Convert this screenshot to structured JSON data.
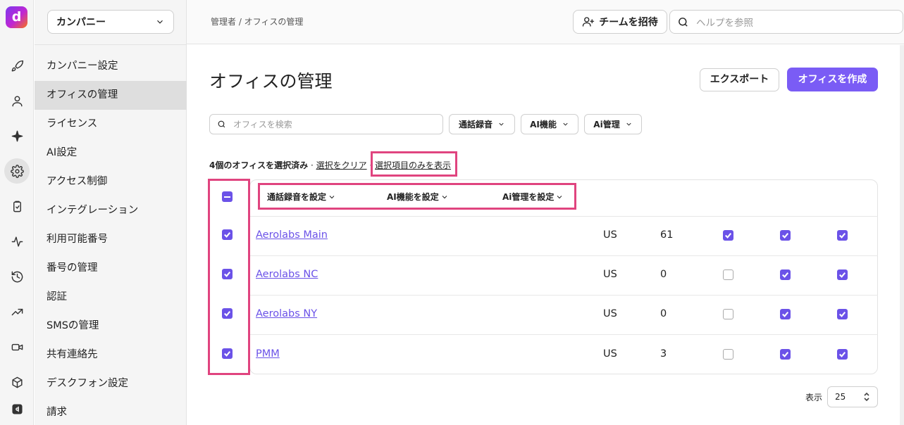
{
  "sidebar": {
    "company": "カンパニー",
    "items": [
      {
        "label": "カンパニー設定",
        "active": false
      },
      {
        "label": "オフィスの管理",
        "active": true
      },
      {
        "label": "ライセンス",
        "active": false
      },
      {
        "label": "AI設定",
        "active": false
      },
      {
        "label": "アクセス制御",
        "active": false
      },
      {
        "label": "インテグレーション",
        "active": false
      },
      {
        "label": "利用可能番号",
        "active": false
      },
      {
        "label": "番号の管理",
        "active": false
      },
      {
        "label": "認証",
        "active": false
      },
      {
        "label": "SMSの管理",
        "active": false
      },
      {
        "label": "共有連絡先",
        "active": false
      },
      {
        "label": "デスクフォン設定",
        "active": false
      },
      {
        "label": "請求",
        "active": false
      }
    ]
  },
  "rail": {
    "logo": "d",
    "icons": [
      "rocket-icon",
      "user-icon",
      "sparkle-icon",
      "gear-icon",
      "clipboard-icon",
      "activity-icon",
      "history-icon",
      "trending-icon",
      "video-icon",
      "box-icon",
      "dialpad-icon"
    ]
  },
  "header": {
    "breadcrumb": "管理者 / オフィスの管理",
    "invite_label": "チームを招待",
    "help_placeholder": "ヘルプを参照"
  },
  "page": {
    "title": "オフィスの管理",
    "export_label": "エクスポート",
    "create_label": "オフィスを作成"
  },
  "filters": {
    "search_placeholder": "オフィスを検索",
    "items": [
      "通話録音",
      "AI機能",
      "Ai管理"
    ]
  },
  "selection": {
    "count_text": "4個のオフィスを選択済み",
    "separator": " · ",
    "clear_label": "選択をクリア",
    "show_selected_label": "選択項目のみを表示"
  },
  "table": {
    "bulk_actions": [
      "通話録音を設定",
      "AI機能を設定",
      "Ai管理を設定"
    ],
    "rows": [
      {
        "name": "Aerolabs Main",
        "country": "US",
        "count": "61",
        "selected": true,
        "recording": true,
        "ai": true,
        "ai_admin": true
      },
      {
        "name": "Aerolabs NC",
        "country": "US",
        "count": "0",
        "selected": true,
        "recording": false,
        "ai": true,
        "ai_admin": true
      },
      {
        "name": "Aerolabs NY",
        "country": "US",
        "count": "0",
        "selected": true,
        "recording": false,
        "ai": true,
        "ai_admin": true
      },
      {
        "name": "PMM",
        "country": "US",
        "count": "3",
        "selected": true,
        "recording": false,
        "ai": true,
        "ai_admin": true
      }
    ]
  },
  "pagination": {
    "label": "表示",
    "page_size": "25"
  },
  "colors": {
    "accent": "#7a5cf5",
    "checkbox": "#6b52e8",
    "highlight": "#e0447f"
  }
}
